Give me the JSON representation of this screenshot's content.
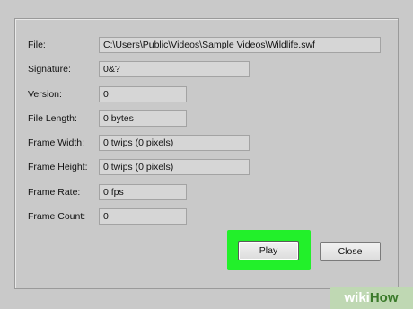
{
  "fields": [
    {
      "label": "File:",
      "value": "C:\\Users\\Public\\Videos\\Sample Videos\\Wildlife.swf"
    },
    {
      "label": "Signature:",
      "value": "0&?"
    },
    {
      "label": "Version:",
      "value": "0"
    },
    {
      "label": "File Length:",
      "value": "0 bytes"
    },
    {
      "label": "Frame Width:",
      "value": "0 twips (0 pixels)"
    },
    {
      "label": "Frame Height:",
      "value": "0 twips (0 pixels)"
    },
    {
      "label": "Frame Rate:",
      "value": "0 fps"
    },
    {
      "label": "Frame Count:",
      "value": "0"
    }
  ],
  "buttons": {
    "play": "Play",
    "close": "Close"
  },
  "highlight_color": "#22f02a",
  "watermark": {
    "part1": "wiki",
    "part2": "How"
  }
}
